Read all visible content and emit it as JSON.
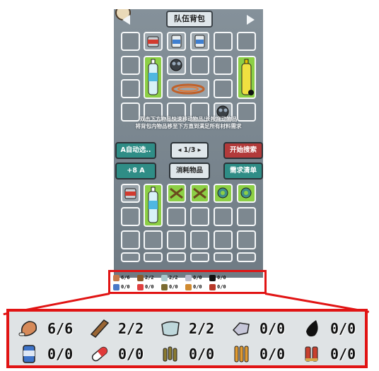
{
  "header": {
    "title": "队伍背包"
  },
  "hint": {
    "line1": "双击下方物品快速移动物品/长按拖动物品",
    "line2": "将背包内物品移至下方直到满足所有材料需求"
  },
  "controls": {
    "auto_select": "A自动选..",
    "pager": "◂ 1/3 ▸",
    "start_search": "开始搜索",
    "video_bonus": "+8 A",
    "section_label": "消耗物品",
    "demand_list": "需求清单"
  },
  "requirements": [
    {
      "icon": "meat-icon",
      "count": "6/6"
    },
    {
      "icon": "wood-plank-icon",
      "count": "2/2"
    },
    {
      "icon": "cloth-icon",
      "count": "2/2"
    },
    {
      "icon": "stone-icon",
      "count": "0/0"
    },
    {
      "icon": "oil-drop-icon",
      "count": "0/0"
    },
    {
      "icon": "canned-food-icon",
      "count": "0/0"
    },
    {
      "icon": "pill-icon",
      "count": "0/0"
    },
    {
      "icon": "bullets-icon",
      "count": "0/0"
    },
    {
      "icon": "ammo-icon",
      "count": "0/0"
    },
    {
      "icon": "shells-icon",
      "count": "0/0"
    }
  ],
  "colors": {
    "highlight": "#e11414",
    "panel": "#7b8790",
    "teal_button": "#2f8d86",
    "red_button": "#b23a3a",
    "item_green": "#8ccf45"
  }
}
